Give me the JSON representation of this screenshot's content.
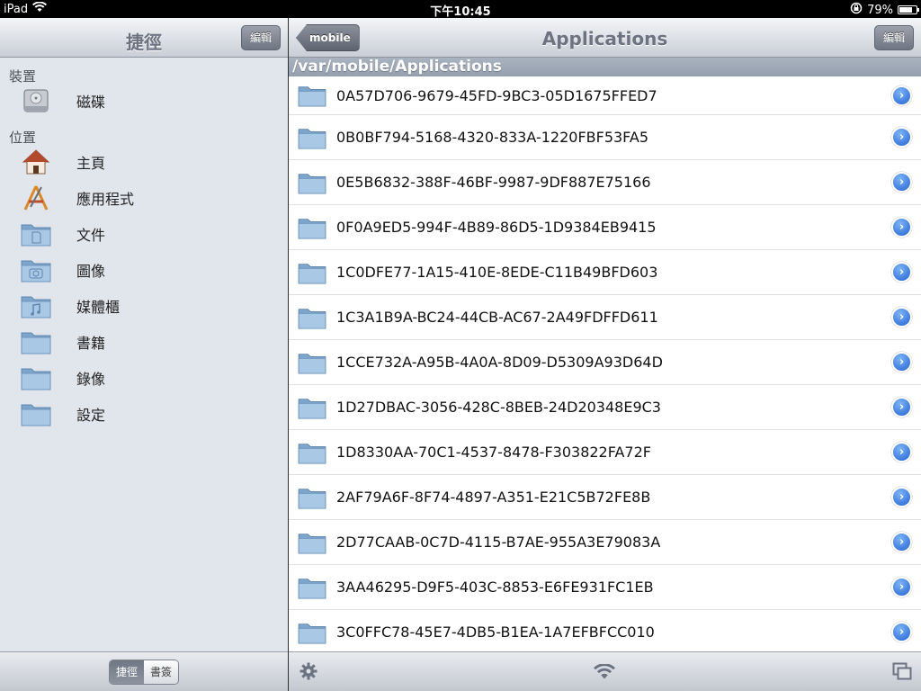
{
  "status_bar": {
    "device": "iPad",
    "time": "下午10:45",
    "battery": "79%",
    "battery_level": 0.79
  },
  "sidebar": {
    "title": "捷徑",
    "edit_label": "編輯",
    "sections": [
      {
        "header": "裝置",
        "items": [
          {
            "label": "磁碟",
            "icon": "disk-icon"
          }
        ]
      },
      {
        "header": "位置",
        "items": [
          {
            "label": "主頁",
            "icon": "home-icon"
          },
          {
            "label": "應用程式",
            "icon": "applications-icon"
          },
          {
            "label": "文件",
            "icon": "documents-folder-icon"
          },
          {
            "label": "圖像",
            "icon": "pictures-folder-icon"
          },
          {
            "label": "媒體櫃",
            "icon": "music-folder-icon"
          },
          {
            "label": "書籍",
            "icon": "folder-icon"
          },
          {
            "label": "錄像",
            "icon": "folder-icon"
          },
          {
            "label": "設定",
            "icon": "folder-icon"
          }
        ]
      }
    ],
    "segments": [
      {
        "label": "捷徑",
        "active": true
      },
      {
        "label": "書簽",
        "active": false
      }
    ]
  },
  "main": {
    "back_label": "mobile",
    "title": "Applications",
    "edit_label": "編輯",
    "path": "/var/mobile/Applications",
    "files": [
      "0A57D706-9679-45FD-9BC3-05D1675FFED7",
      "0B0BF794-5168-4320-833A-1220FBF53FA5",
      "0E5B6832-388F-46BF-9987-9DF887E75166",
      "0F0A9ED5-994F-4B89-86D5-1D9384EB9415",
      "1C0DFE77-1A15-410E-8EDE-C11B49BFD603",
      "1C3A1B9A-BC24-44CB-AC67-2A49FDFFD611",
      "1CCE732A-A95B-4A0A-8D09-D5309A93D64D",
      "1D27DBAC-3056-428C-8BEB-24D20348E9C3",
      "1D8330AA-70C1-4537-8478-F303822FA72F",
      "2AF79A6F-8F74-4897-A351-E21C5B72FE8B",
      "2D77CAAB-0C7D-4115-B7AE-955A3E79083A",
      "3AA46295-D9F5-403C-8853-E6FE931FC1EB",
      "3C0FFC78-45E7-4DB5-B1EA-1A7EFBFCC010"
    ],
    "toolbar_icons": [
      "gear-icon",
      "wifi-icon",
      "windows-icon"
    ]
  },
  "colors": {
    "accent_blue": "#2161d3",
    "sidebar_bg": "#e1e5ec",
    "path_bar": "#9fa9b7"
  }
}
